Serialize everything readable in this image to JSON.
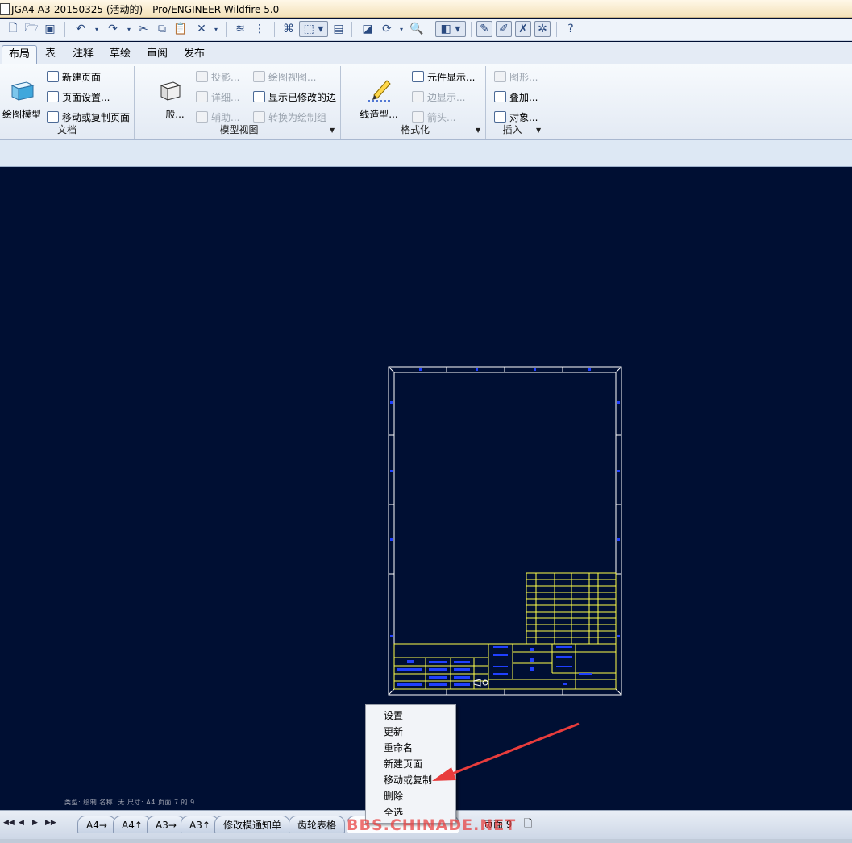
{
  "window": {
    "title": "JGA4-A3-20150325 (活动的) - Pro/ENGINEER Wildfire 5.0"
  },
  "tabs": [
    {
      "label": "布局"
    },
    {
      "label": "表"
    },
    {
      "label": "注释"
    },
    {
      "label": "草绘"
    },
    {
      "label": "审阅"
    },
    {
      "label": "发布"
    }
  ],
  "ribbon": {
    "document": {
      "label": "文档",
      "drawing_model": "绘图模型",
      "new_page": "新建页面",
      "page_setup": "页面设置...",
      "move_copy_page": "移动或复制页面"
    },
    "model_views": {
      "label": "模型视图",
      "general": "一般...",
      "projection": "投影...",
      "detailed": "详细...",
      "auxiliary": "辅助...",
      "drawing_view": "绘图视图...",
      "show_modified_edges": "显示已修改的边",
      "convert_to_draw_group": "转换为绘制组"
    },
    "format": {
      "label": "格式化",
      "line_style": "线造型...",
      "component_display": "元件显示...",
      "edge_display": "边显示...",
      "arrows": "箭头..."
    },
    "insert": {
      "label": "插入",
      "graphics": "图形...",
      "overlay": "叠加...",
      "object": "对象..."
    }
  },
  "status_info": "类型: 绘制    名称: 无    尺寸: A4    页面 7 的 9",
  "context_menu": {
    "items": [
      {
        "label": "设置"
      },
      {
        "label": "更新"
      },
      {
        "label": "重命名"
      },
      {
        "label": "新建页面"
      },
      {
        "label": "移动或复制"
      },
      {
        "label": "删除"
      },
      {
        "label": "全选"
      }
    ]
  },
  "sheets": {
    "tabs": [
      {
        "label": "A4→"
      },
      {
        "label": "A4↑"
      },
      {
        "label": "A3→"
      },
      {
        "label": "A3↑"
      },
      {
        "label": "修改模通知单"
      },
      {
        "label": "齿轮表格"
      }
    ],
    "page9": "页面 9"
  },
  "watermark": "BBS.CHINADE.NET",
  "colors": {
    "canvas_bg": "#000f33",
    "frame_white": "#ffffff",
    "table_yellow": "#ffff4a",
    "accent_blue": "#2040ff",
    "arrow_red": "#e83c3c"
  },
  "icons": [
    "new-file-icon",
    "open-folder-icon",
    "save-icon",
    "undo-icon",
    "redo-icon",
    "cut-icon",
    "copy-icon",
    "paste-icon",
    "delete-icon",
    "layer-icon",
    "model-tree-icon",
    "binoculars-icon",
    "box-select-icon",
    "measure-icon",
    "repaint-icon",
    "regenerate-icon",
    "zoom-icon",
    "display-style-icon",
    "sketch-tool-icon",
    "whats-this-icon"
  ]
}
